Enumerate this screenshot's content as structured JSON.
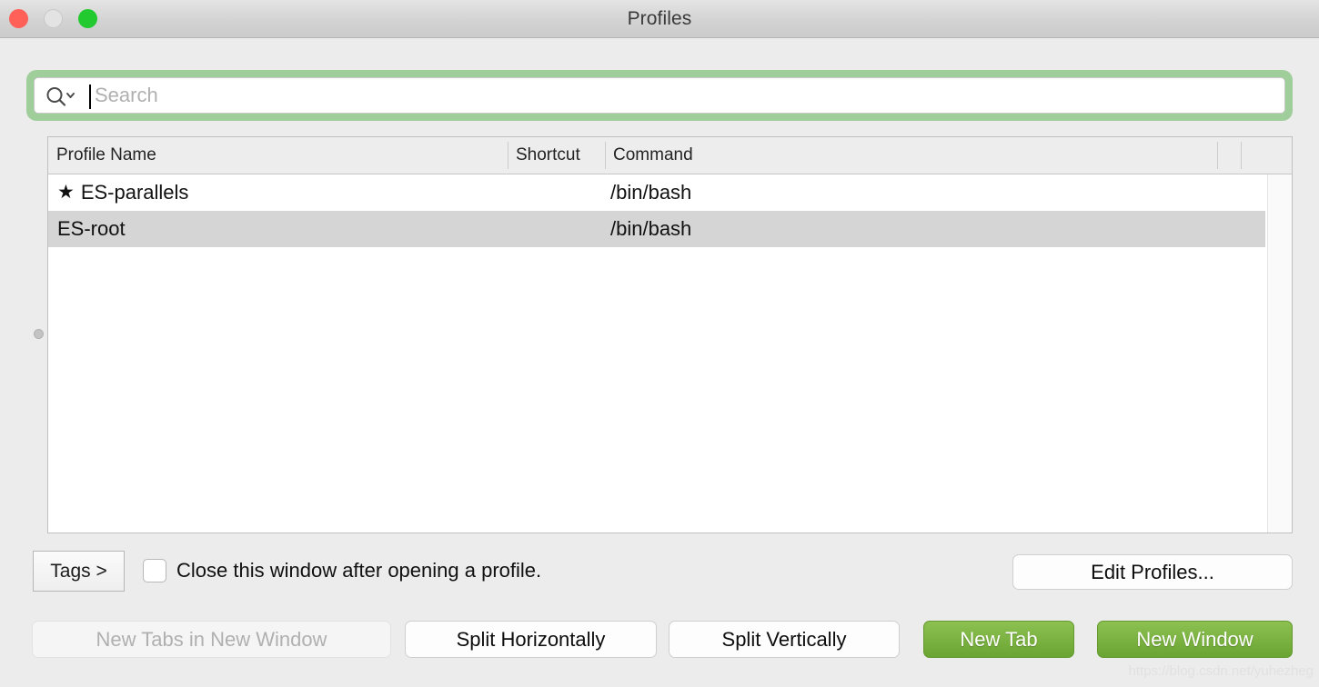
{
  "window": {
    "title": "Profiles",
    "traffic_lights": [
      {
        "name": "close",
        "color": "#ff6159"
      },
      {
        "name": "minimize",
        "color": "#e3e3e3"
      },
      {
        "name": "zoom",
        "color": "#22c92f"
      }
    ]
  },
  "search": {
    "value": "",
    "placeholder": "Search",
    "icon": "search-icon",
    "dropdown_icon": "chevron-down-icon",
    "focus_ring_color": "#9fce9b"
  },
  "table": {
    "columns": [
      "Profile Name",
      "Shortcut",
      "Command"
    ],
    "rows": [
      {
        "favorite": true,
        "star_glyph": "★",
        "profile_name": "ES-parallels",
        "shortcut": "",
        "command": "/bin/bash",
        "selected": false
      },
      {
        "favorite": false,
        "star_glyph": "",
        "profile_name": "ES-root",
        "shortcut": "",
        "command": "/bin/bash",
        "selected": true
      }
    ],
    "selection_color": "#d5d5d5"
  },
  "options": {
    "tags_label": "Tags >",
    "close_window_checkbox": {
      "label": "Close this window after opening a profile.",
      "checked": false
    },
    "edit_profiles_label": "Edit Profiles..."
  },
  "footer": {
    "buttons": [
      {
        "label": "New Tabs in New Window",
        "style": "disabled"
      },
      {
        "label": "Split Horizontally",
        "style": "plain"
      },
      {
        "label": "Split Vertically",
        "style": "plain"
      },
      {
        "label": "New Tab",
        "style": "green"
      },
      {
        "label": "New Window",
        "style": "green"
      }
    ],
    "accent_color": "#7cb342"
  },
  "watermark": {
    "text": "https://blog.csdn.net/yuhezheg"
  }
}
